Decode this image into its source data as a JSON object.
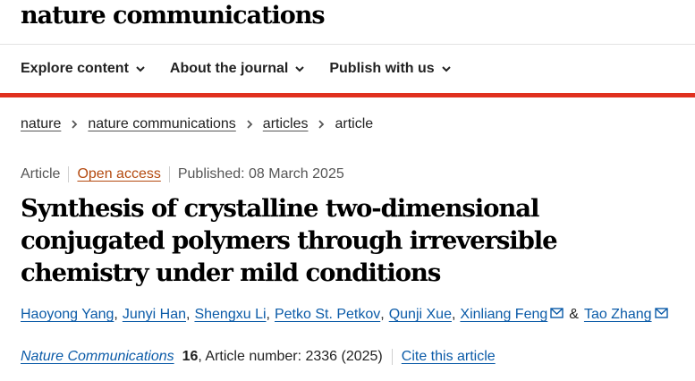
{
  "site": {
    "logo": "nature communications"
  },
  "nav": {
    "items": [
      {
        "label": "Explore content"
      },
      {
        "label": "About the journal"
      },
      {
        "label": "Publish with us"
      }
    ]
  },
  "breadcrumb": {
    "items": [
      "nature",
      "nature communications",
      "articles"
    ],
    "current": "article"
  },
  "meta": {
    "type": "Article",
    "access": "Open access",
    "published": "Published: 08 March 2025"
  },
  "title": "Synthesis of crystalline two-dimensional conjugated polymers through irreversible chemistry under mild conditions",
  "authors": {
    "list": [
      "Haoyong Yang",
      "Junyi Han",
      "Shengxu Li",
      "Petko St. Petkov",
      "Qunji Xue",
      "Xinliang Feng",
      "Tao Zhang"
    ],
    "separator": ",",
    "conjunction": "&"
  },
  "citation": {
    "journal": "Nature Communications",
    "volume": "16",
    "article_info": ", Article number: 2336 (2025)",
    "cite_label": "Cite this article"
  },
  "colors": {
    "accent_red": "#e0301e",
    "link_blue": "#0b5ba8",
    "open_access_orange": "#b44a10"
  },
  "icons": [
    "chevron-down-icon",
    "chevron-right-icon",
    "mail-icon"
  ]
}
